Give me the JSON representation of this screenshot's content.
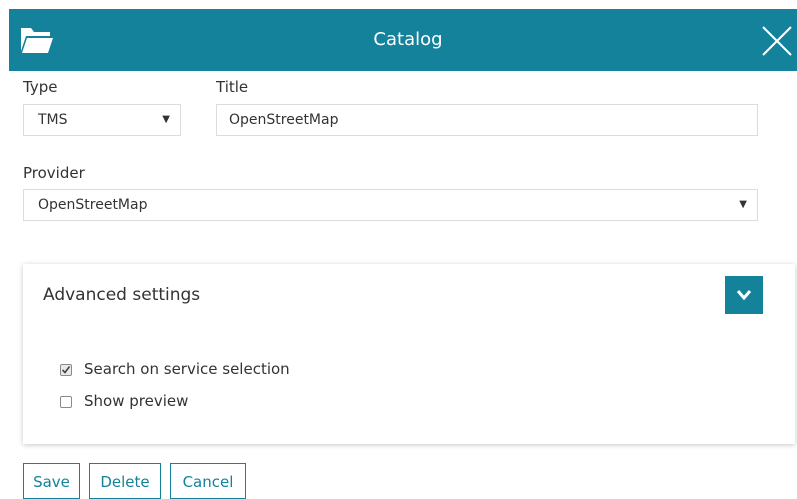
{
  "header": {
    "title": "Catalog",
    "icon": "folder-open-icon",
    "close_icon": "close-icon",
    "color": "#15829b"
  },
  "form": {
    "type": {
      "label": "Type",
      "value": "TMS"
    },
    "title": {
      "label": "Title",
      "value": "OpenStreetMap"
    },
    "provider": {
      "label": "Provider",
      "value": "OpenStreetMap"
    }
  },
  "advanced": {
    "title": "Advanced settings",
    "toggle_icon": "chevron-down-icon",
    "options": [
      {
        "label": "Search on service selection",
        "checked": true
      },
      {
        "label": "Show preview",
        "checked": false
      }
    ]
  },
  "actions": {
    "save": "Save",
    "delete": "Delete",
    "cancel": "Cancel"
  }
}
